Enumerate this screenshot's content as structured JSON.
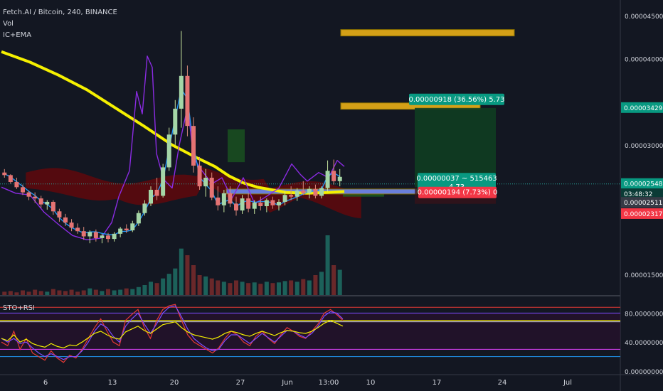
{
  "header": {
    "title": "Fetch.AI / Bitcoin, 240, BINANCE",
    "vol": "Vol",
    "indicator": "IC+EMA"
  },
  "sub_pane": {
    "title": "STO+RSI"
  },
  "colors": {
    "bg": "#131722",
    "up": "#26a69a",
    "down": "#ef5350",
    "ema": "#f5f000",
    "rsi": "#8a2be2",
    "blue": "#2196f3",
    "cloud_bear": "#8b0000",
    "cloud_bull": "#1b5e20"
  },
  "chart_data": [
    {
      "type": "candlestick",
      "title": "Fetch.AI / Bitcoin, 240, BINANCE",
      "x_ticks": [
        "6",
        "13",
        "20",
        "27",
        "Jun",
        "13:00",
        "10",
        "17",
        "24",
        "Jul"
      ],
      "y_ticks": [
        "0.00004500",
        "0.00004000",
        "0.00003429",
        "0.00003000",
        "0.00002548",
        "0.00002511",
        "0.00002317",
        "0.00001500"
      ],
      "ylim": [
        1.26e-05,
        4.68e-05
      ],
      "price_tags": [
        {
          "label": "0.00003429",
          "price": 3.429e-05,
          "color": "#089981"
        },
        {
          "label": "0.00002548",
          "price": 2.548e-05,
          "color": "#089981"
        },
        {
          "label": "03:48:32",
          "price": 2.43e-05,
          "color": "#0b3b36"
        },
        {
          "label": "0.00002511",
          "price": 2.33e-05,
          "color": "#363a45"
        },
        {
          "label": "0.00002317",
          "price": 2.2e-05,
          "color": "#f23645"
        }
      ],
      "last_price": 2.548e-05,
      "zones": [
        {
          "name": "target-2",
          "price": 4.3e-05,
          "color": "#d4a017"
        },
        {
          "name": "target-1",
          "price": 3.45e-05,
          "color": "#d4a017"
        },
        {
          "name": "support",
          "price": 2.46e-05,
          "color": "#6a7fdb"
        }
      ],
      "position": {
        "entry": 2.511e-05,
        "target": 3.429e-05,
        "stop": 2.317e-05,
        "target_label": "0.00000918 (36.56%) 5.73",
        "entry_label": [
          "0.00000037 ~ 515463",
          "4.73"
        ],
        "stop_label": "0.00000194 (7.73%) 0"
      },
      "series": [
        {
          "name": "EMA",
          "kind": "ema",
          "points": [
            [
              0,
              4.08e-05
            ],
            [
              40,
              3.96e-05
            ],
            [
              80,
              3.81e-05
            ],
            [
              120,
              3.64e-05
            ],
            [
              160,
              3.43e-05
            ],
            [
              200,
              3.22e-05
            ],
            [
              240,
              3e-05
            ],
            [
              270,
              2.87e-05
            ],
            [
              300,
              2.75e-05
            ],
            [
              320,
              2.64e-05
            ],
            [
              340,
              2.56e-05
            ],
            [
              360,
              2.51e-05
            ],
            [
              380,
              2.48e-05
            ],
            [
              400,
              2.45e-05
            ],
            [
              430,
              2.44e-05
            ],
            [
              460,
              2.45e-05
            ],
            [
              482,
              2.46e-05
            ]
          ]
        },
        {
          "name": "RSI-line",
          "kind": "rsi",
          "points": [
            [
              0,
              2.51e-05
            ],
            [
              20,
              2.44e-05
            ],
            [
              40,
              2.42e-05
            ],
            [
              60,
              2.22e-05
            ],
            [
              80,
              2.08e-05
            ],
            [
              100,
              1.95e-05
            ],
            [
              120,
              1.9e-05
            ],
            [
              140,
              1.92e-05
            ],
            [
              155,
              2.1e-05
            ],
            [
              165,
              2.4e-05
            ],
            [
              180,
              2.7e-05
            ],
            [
              190,
              3.62e-05
            ],
            [
              198,
              3.36e-05
            ],
            [
              205,
              4.03e-05
            ],
            [
              212,
              3.9e-05
            ],
            [
              218,
              2.9e-05
            ],
            [
              228,
              2.6e-05
            ],
            [
              240,
              2.5e-05
            ],
            [
              250,
              3e-05
            ],
            [
              262,
              3.45e-05
            ],
            [
              270,
              2.85e-05
            ],
            [
              282,
              2.7e-05
            ],
            [
              296,
              2.55e-05
            ],
            [
              310,
              2.62e-05
            ],
            [
              324,
              2.38e-05
            ],
            [
              340,
              2.62e-05
            ],
            [
              356,
              2.32e-05
            ],
            [
              372,
              2.4e-05
            ],
            [
              390,
              2.5e-05
            ],
            [
              408,
              2.78e-05
            ],
            [
              420,
              2.66e-05
            ],
            [
              430,
              2.58e-05
            ],
            [
              446,
              2.68e-05
            ],
            [
              460,
              2.62e-05
            ],
            [
              472,
              2.82e-05
            ],
            [
              482,
              2.75e-05
            ]
          ]
        },
        {
          "name": "Candles",
          "kind": "candles",
          "ohlc": [
            [
              2.68e-05,
              2.72e-05,
              2.62e-05,
              2.65e-05
            ],
            [
              2.65e-05,
              2.66e-05,
              2.55e-05,
              2.57e-05
            ],
            [
              2.57e-05,
              2.62e-05,
              2.49e-05,
              2.51e-05
            ],
            [
              2.51e-05,
              2.54e-05,
              2.42e-05,
              2.45e-05
            ],
            [
              2.45e-05,
              2.47e-05,
              2.36e-05,
              2.4e-05
            ],
            [
              2.4e-05,
              2.45e-05,
              2.33e-05,
              2.38e-05
            ],
            [
              2.38e-05,
              2.41e-05,
              2.27e-05,
              2.31e-05
            ],
            [
              2.31e-05,
              2.36e-05,
              2.25e-05,
              2.34e-05
            ],
            [
              2.34e-05,
              2.36e-05,
              2.19e-05,
              2.23e-05
            ],
            [
              2.23e-05,
              2.26e-05,
              2.11e-05,
              2.16e-05
            ],
            [
              2.16e-05,
              2.2e-05,
              2.06e-05,
              2.1e-05
            ],
            [
              2.1e-05,
              2.14e-05,
              2e-05,
              2.04e-05
            ],
            [
              2.04e-05,
              2.09e-05,
              1.97e-05,
              2e-05
            ],
            [
              2e-05,
              2.05e-05,
              1.9e-05,
              1.94e-05
            ],
            [
              1.94e-05,
              2.01e-05,
              1.86e-05,
              1.99e-05
            ],
            [
              1.99e-05,
              2.02e-05,
              1.88e-05,
              1.92e-05
            ],
            [
              1.92e-05,
              1.97e-05,
              1.86e-05,
              1.95e-05
            ],
            [
              1.95e-05,
              1.98e-05,
              1.87e-05,
              1.91e-05
            ],
            [
              1.91e-05,
              1.99e-05,
              1.88e-05,
              1.97e-05
            ],
            [
              1.97e-05,
              2.05e-05,
              1.93e-05,
              2.03e-05
            ],
            [
              2.03e-05,
              2.08e-05,
              1.98e-05,
              2.01e-05
            ],
            [
              2.01e-05,
              2.12e-05,
              1.99e-05,
              2.09e-05
            ],
            [
              2.09e-05,
              2.24e-05,
              2.06e-05,
              2.21e-05
            ],
            [
              2.21e-05,
              2.36e-05,
              2.18e-05,
              2.32e-05
            ],
            [
              2.32e-05,
              2.52e-05,
              2.29e-05,
              2.48e-05
            ],
            [
              2.48e-05,
              2.62e-05,
              2.36e-05,
              2.41e-05
            ],
            [
              2.41e-05,
              2.78e-05,
              2.39e-05,
              2.74e-05
            ],
            [
              2.74e-05,
              3.2e-05,
              2.7e-05,
              3.12e-05
            ],
            [
              3.12e-05,
              3.52e-05,
              3e-05,
              3.42e-05
            ],
            [
              3.42e-05,
              4.32e-05,
              3.2e-05,
              3.8e-05
            ],
            [
              3.8e-05,
              3.92e-05,
              3.1e-05,
              3.22e-05
            ],
            [
              3.22e-05,
              3.32e-05,
              2.68e-05,
              2.76e-05
            ],
            [
              2.76e-05,
              2.86e-05,
              2.48e-05,
              2.52e-05
            ],
            [
              2.52e-05,
              2.72e-05,
              2.4e-05,
              2.62e-05
            ],
            [
              2.62e-05,
              2.68e-05,
              2.36e-05,
              2.39e-05
            ],
            [
              2.39e-05,
              2.52e-05,
              2.24e-05,
              2.3e-05
            ],
            [
              2.3e-05,
              2.48e-05,
              2.22e-05,
              2.44e-05
            ],
            [
              2.44e-05,
              2.52e-05,
              2.28e-05,
              2.32e-05
            ],
            [
              2.32e-05,
              2.4e-05,
              2.18e-05,
              2.24e-05
            ],
            [
              2.24e-05,
              2.42e-05,
              2.2e-05,
              2.38e-05
            ],
            [
              2.38e-05,
              2.44e-05,
              2.22e-05,
              2.26e-05
            ],
            [
              2.26e-05,
              2.36e-05,
              2.2e-05,
              2.33e-05
            ],
            [
              2.33e-05,
              2.4e-05,
              2.24e-05,
              2.29e-05
            ],
            [
              2.29e-05,
              2.38e-05,
              2.22e-05,
              2.36e-05
            ],
            [
              2.36e-05,
              2.4e-05,
              2.26e-05,
              2.3e-05
            ],
            [
              2.3e-05,
              2.37e-05,
              2.24e-05,
              2.34e-05
            ],
            [
              2.34e-05,
              2.46e-05,
              2.3e-05,
              2.42e-05
            ],
            [
              2.42e-05,
              2.52e-05,
              2.36e-05,
              2.4e-05
            ],
            [
              2.4e-05,
              2.5e-05,
              2.35e-05,
              2.47e-05
            ],
            [
              2.47e-05,
              2.58e-05,
              2.42e-05,
              2.44e-05
            ],
            [
              2.44e-05,
              2.52e-05,
              2.38e-05,
              2.49e-05
            ],
            [
              2.49e-05,
              2.54e-05,
              2.38e-05,
              2.41e-05
            ],
            [
              2.41e-05,
              2.52e-05,
              2.38e-05,
              2.5e-05
            ],
            [
              2.5e-05,
              2.82e-05,
              2.46e-05,
              2.7e-05
            ],
            [
              2.7e-05,
              2.83e-05,
              2.54e-05,
              2.58e-05
            ],
            [
              2.58e-05,
              2.72e-05,
              2.52e-05,
              2.63e-05
            ]
          ]
        },
        {
          "name": "Volume",
          "kind": "volume",
          "values": [
            5,
            6,
            4,
            7,
            5,
            8,
            6,
            5,
            9,
            7,
            6,
            8,
            5,
            7,
            10,
            8,
            6,
            9,
            7,
            8,
            10,
            9,
            12,
            15,
            20,
            18,
            25,
            32,
            40,
            70,
            60,
            45,
            30,
            28,
            25,
            22,
            20,
            18,
            22,
            20,
            18,
            19,
            17,
            20,
            18,
            19,
            21,
            22,
            20,
            24,
            22,
            30,
            35,
            90,
            45,
            38
          ]
        }
      ]
    },
    {
      "type": "line",
      "title": "STO+RSI",
      "y_ticks": [
        "80.00000000",
        "40.00000000",
        "0.00000000"
      ],
      "ylim": [
        0,
        100
      ],
      "levels": [
        {
          "value": 88,
          "color": "#e53935"
        },
        {
          "value": 80,
          "color": "#7c4dff"
        },
        {
          "value": 70,
          "color": "#f5f000"
        },
        {
          "value": 68,
          "color": "#e0e0e0"
        },
        {
          "value": 30,
          "color": "#e040fb"
        },
        {
          "value": 20,
          "color": "#2196f3"
        }
      ],
      "series": [
        {
          "name": "K",
          "color": "#e53935",
          "values": [
            40,
            35,
            55,
            30,
            45,
            25,
            20,
            15,
            28,
            18,
            12,
            22,
            18,
            30,
            45,
            60,
            72,
            55,
            40,
            35,
            70,
            78,
            85,
            60,
            45,
            70,
            85,
            90,
            92,
            70,
            50,
            40,
            35,
            30,
            25,
            32,
            45,
            55,
            50,
            40,
            35,
            48,
            55,
            45,
            38,
            50,
            60,
            55,
            48,
            45,
            55,
            65,
            80,
            85,
            78,
            70
          ]
        },
        {
          "name": "D",
          "color": "#7c4dff",
          "values": [
            45,
            40,
            45,
            38,
            40,
            32,
            25,
            20,
            24,
            20,
            16,
            20,
            20,
            28,
            40,
            55,
            65,
            60,
            48,
            40,
            62,
            72,
            80,
            65,
            52,
            65,
            80,
            88,
            90,
            75,
            58,
            45,
            38,
            32,
            28,
            30,
            42,
            50,
            50,
            44,
            38,
            45,
            52,
            46,
            40,
            48,
            56,
            55,
            50,
            46,
            52,
            62,
            76,
            82,
            80,
            72
          ]
        },
        {
          "name": "RSI",
          "color": "#f5f000",
          "values": [
            45,
            42,
            50,
            40,
            44,
            38,
            35,
            33,
            38,
            34,
            32,
            36,
            35,
            40,
            46,
            52,
            55,
            50,
            46,
            44,
            54,
            58,
            62,
            56,
            52,
            58,
            64,
            66,
            68,
            60,
            54,
            50,
            48,
            46,
            44,
            47,
            52,
            55,
            53,
            50,
            48,
            52,
            55,
            52,
            49,
            53,
            56,
            55,
            53,
            52,
            55,
            60,
            66,
            70,
            66,
            62
          ]
        }
      ]
    }
  ]
}
